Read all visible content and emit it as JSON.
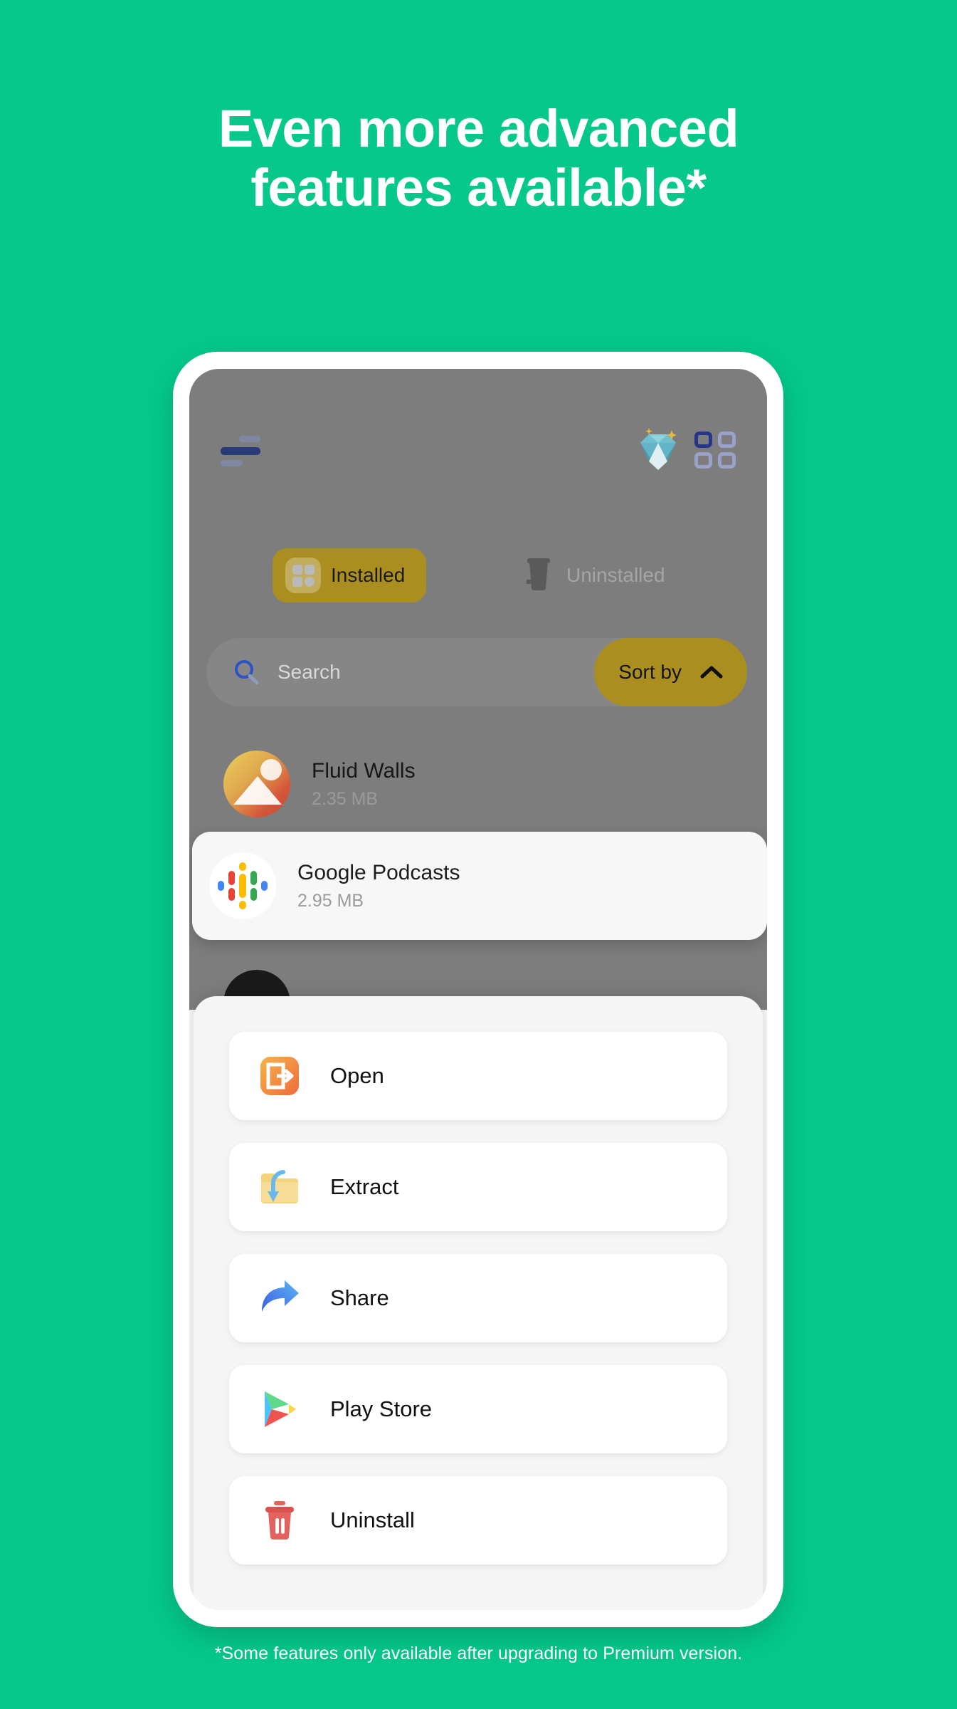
{
  "promo": {
    "headline_line1": "Even more advanced",
    "headline_line2": "features available*",
    "footnote": "*Some features only available after upgrading to Premium version.",
    "background_color": "#05c88a",
    "headline_color": "#ffffff"
  },
  "app": {
    "appbar": {
      "sort_icon": "sort-icon",
      "premium_icon": "diamond-icon",
      "grid_icon": "grid-view-icon"
    },
    "tabs": [
      {
        "label": "Installed",
        "icon": "apps-grid-icon",
        "selected": true
      },
      {
        "label": "Uninstalled",
        "icon": "trash-bin-icon",
        "selected": false
      }
    ],
    "search": {
      "placeholder": "Search",
      "icon": "search-icon",
      "sort_button_label": "Sort by",
      "sort_button_icon": "chevron-up-icon"
    },
    "accent_color": "#ab8e20",
    "app_list": [
      {
        "name": "Fluid Walls",
        "size": "2.35 MB",
        "icon": "fluid-walls-icon",
        "selected": false
      },
      {
        "name": "Google Podcasts",
        "size": "2.95 MB",
        "icon": "google-podcasts-icon",
        "selected": true
      }
    ]
  },
  "action_sheet": {
    "items": [
      {
        "label": "Open",
        "icon": "open-export-icon"
      },
      {
        "label": "Extract",
        "icon": "extract-folder-icon"
      },
      {
        "label": "Share",
        "icon": "share-arrow-icon"
      },
      {
        "label": "Play Store",
        "icon": "play-store-icon"
      },
      {
        "label": "Uninstall",
        "icon": "trash-delete-icon"
      }
    ]
  }
}
